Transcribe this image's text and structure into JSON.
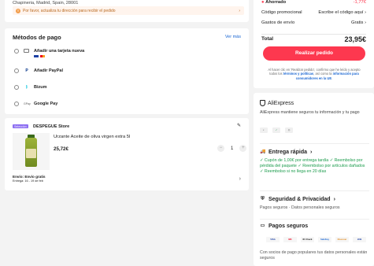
{
  "address": {
    "line": "Chapineria, Madrid, Spain, 28001",
    "alert": "Por favor, actualiza tu dirección para recibir el pedido",
    "alert_icon": "warning-icon"
  },
  "payment": {
    "title": "Métodos de pago",
    "see_more": "Ver más",
    "methods": [
      {
        "label": "Añadir una tarjeta nueva",
        "icon": "credit-card-icon"
      },
      {
        "label": "Añadir PayPal",
        "icon": "paypal-icon"
      },
      {
        "label": "Bizum",
        "icon": "bizum-icon"
      },
      {
        "label": "Google Pay",
        "icon": "google-pay-icon"
      }
    ]
  },
  "store": {
    "badge": "Selección",
    "name": "DESPEGUE Store",
    "product_name": "Urzante Aceite de oliva virgen extra 5l",
    "price": "25,72€",
    "quantity": "1",
    "minus": "−",
    "plus": "+",
    "shipping": "Envío: Envío gratis",
    "delivery": "Entrega: 16 - 19 de feb"
  },
  "summary": {
    "savings_label": "Ahorrado",
    "savings_value": "-1,77€",
    "promo_label": "Código promocional",
    "promo_value": "Escribe el código aquí",
    "shipping_label": "Gastos de envío",
    "shipping_value": "Gratis",
    "total_label": "Total",
    "total_value": "23,95€",
    "cta": "Realizar pedido",
    "legal_1": "Al hacer clic en 'Realizar pedido', confirmo que he leído y acepto todos los ",
    "legal_link1": "términos y políticas",
    "legal_2": ", así como la ",
    "legal_link2": "información para consumidores en la UE",
    "legal_3": "."
  },
  "trust": {
    "brand": "AliExpress",
    "description": "AliExpress mantiene seguros tu información y tu pago",
    "fast_title": "Entrega rápida",
    "fast_line1": "✓ Cupón de 1,00€ por entrega tardía",
    "fast_line2": "✓ Reembolso por pérdida del paquete",
    "fast_line3": "✓ Reembolso por artículos dañados",
    "fast_line4": "✓ Reembolso si no llega en 20 días",
    "security_title": "Seguridad & Privacidad",
    "security_body": "Pagos seguros · Datos personales seguros",
    "payments_title": "Pagos seguros",
    "payments_body": "Con socios de pago populares tus datos personales están seguros",
    "pay_logos": [
      "VISA",
      "MC",
      "ID Check",
      "SafeKey",
      "Discover",
      "JCB"
    ]
  },
  "colors": {
    "accent": "#fd384f",
    "link": "#1a66d2",
    "success": "#1a9b4b",
    "warning_bg": "#fff4ed"
  }
}
